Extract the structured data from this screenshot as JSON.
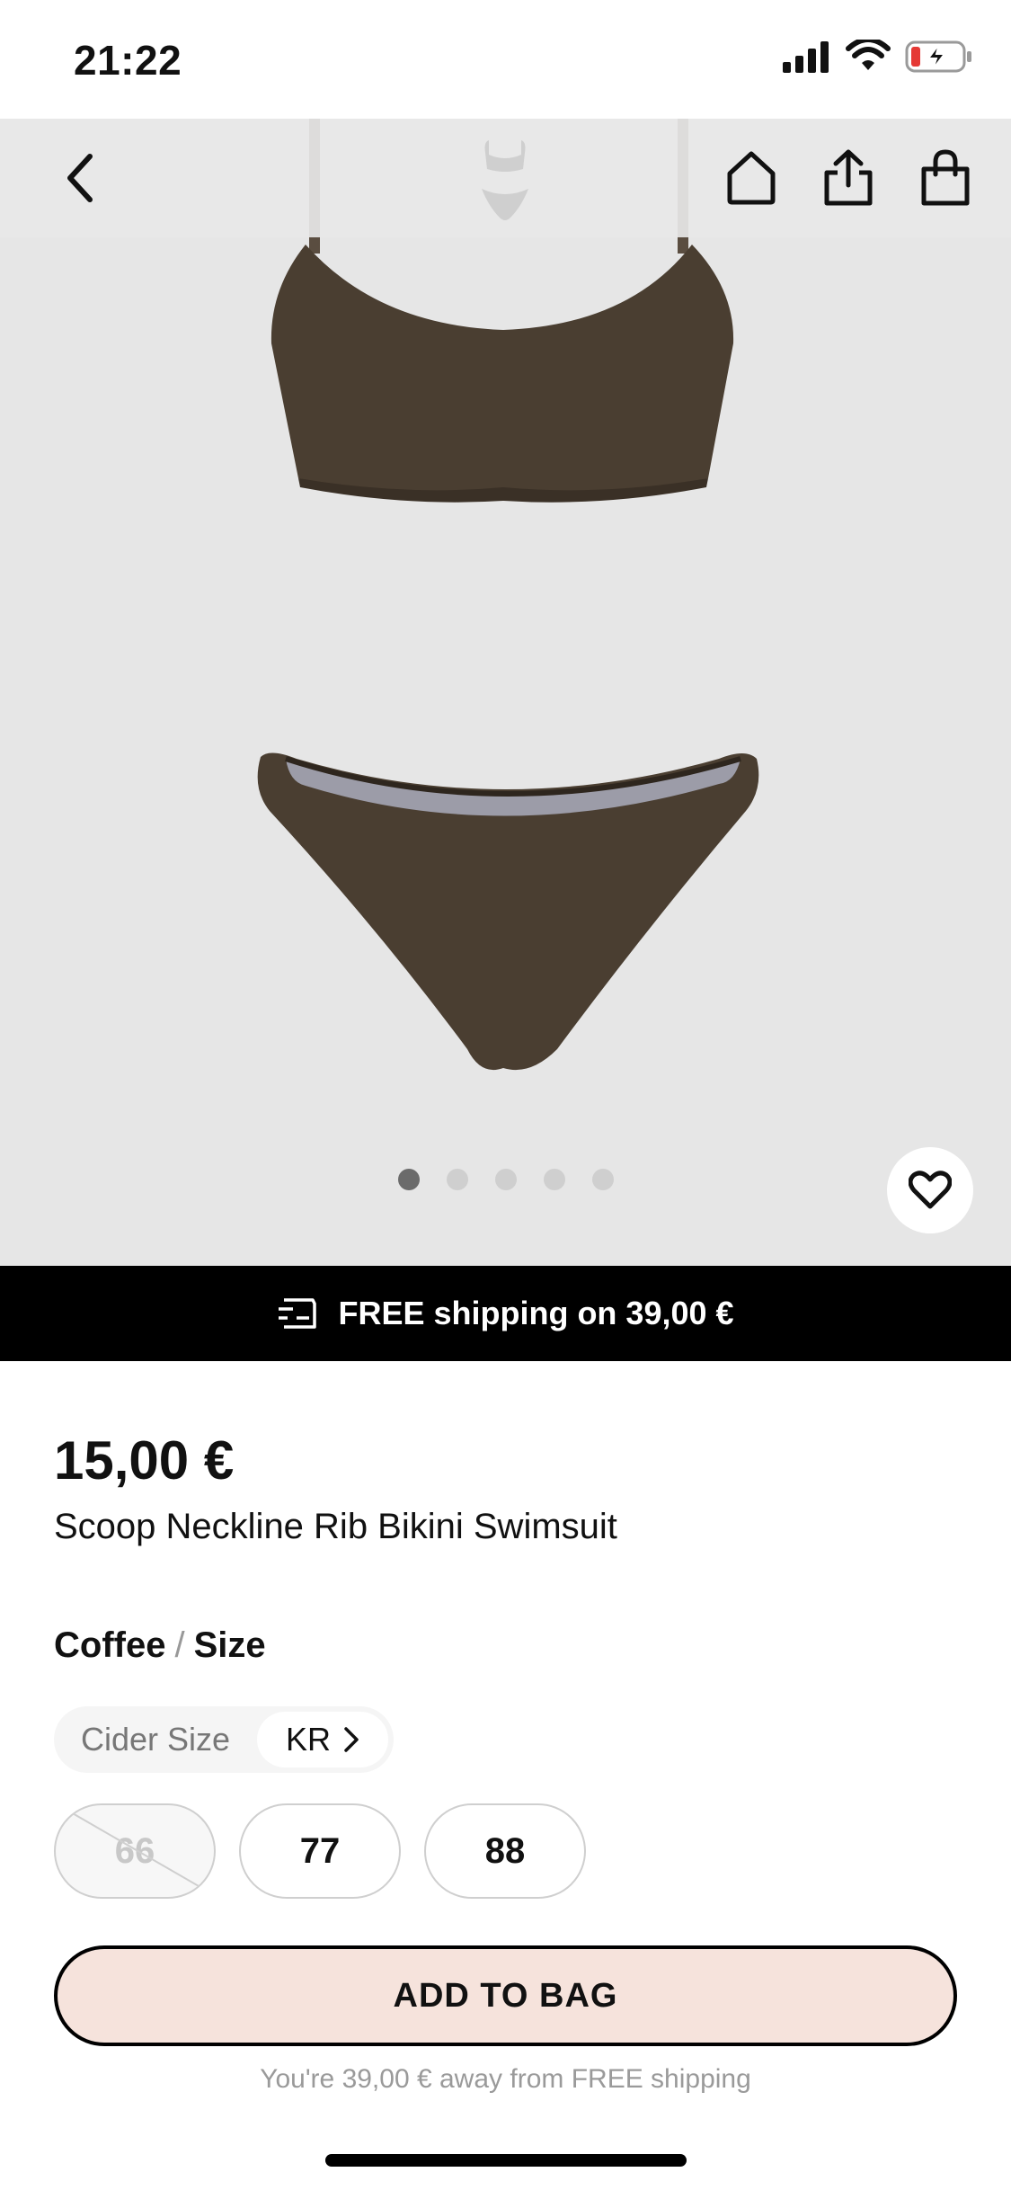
{
  "status_bar": {
    "time": "21:22",
    "icons": [
      "signal-icon",
      "wifi-icon",
      "battery-charging-icon"
    ]
  },
  "hero": {
    "nav_icons": [
      "back-chevron-icon",
      "home-icon",
      "share-icon",
      "shopping-bag-icon"
    ],
    "image_count": 5,
    "active_image_index": 0,
    "favorite_icon": "heart-icon",
    "colors": {
      "background": "#e6e6e6",
      "garment": "#4a3e31"
    }
  },
  "shipping_banner": {
    "icon": "shipping-truck-icon",
    "text": "FREE shipping on 39,00 €"
  },
  "product": {
    "price": "15,00 €",
    "title": "Scoop Neckline Rib Bikini Swimsuit",
    "color_name": "Coffee",
    "separator": "/",
    "size_label": "Size"
  },
  "size_system": {
    "label": "Cider Size",
    "region": "KR"
  },
  "sizes": [
    {
      "label": "66",
      "available": false
    },
    {
      "label": "77",
      "available": true
    },
    {
      "label": "88",
      "available": true
    }
  ],
  "cta": {
    "add_to_bag": "ADD TO BAG",
    "shipping_note": "You're 39,00 € away from FREE shipping",
    "colors": {
      "button_fill": "#f6e3dc",
      "button_border": "#000000"
    }
  }
}
